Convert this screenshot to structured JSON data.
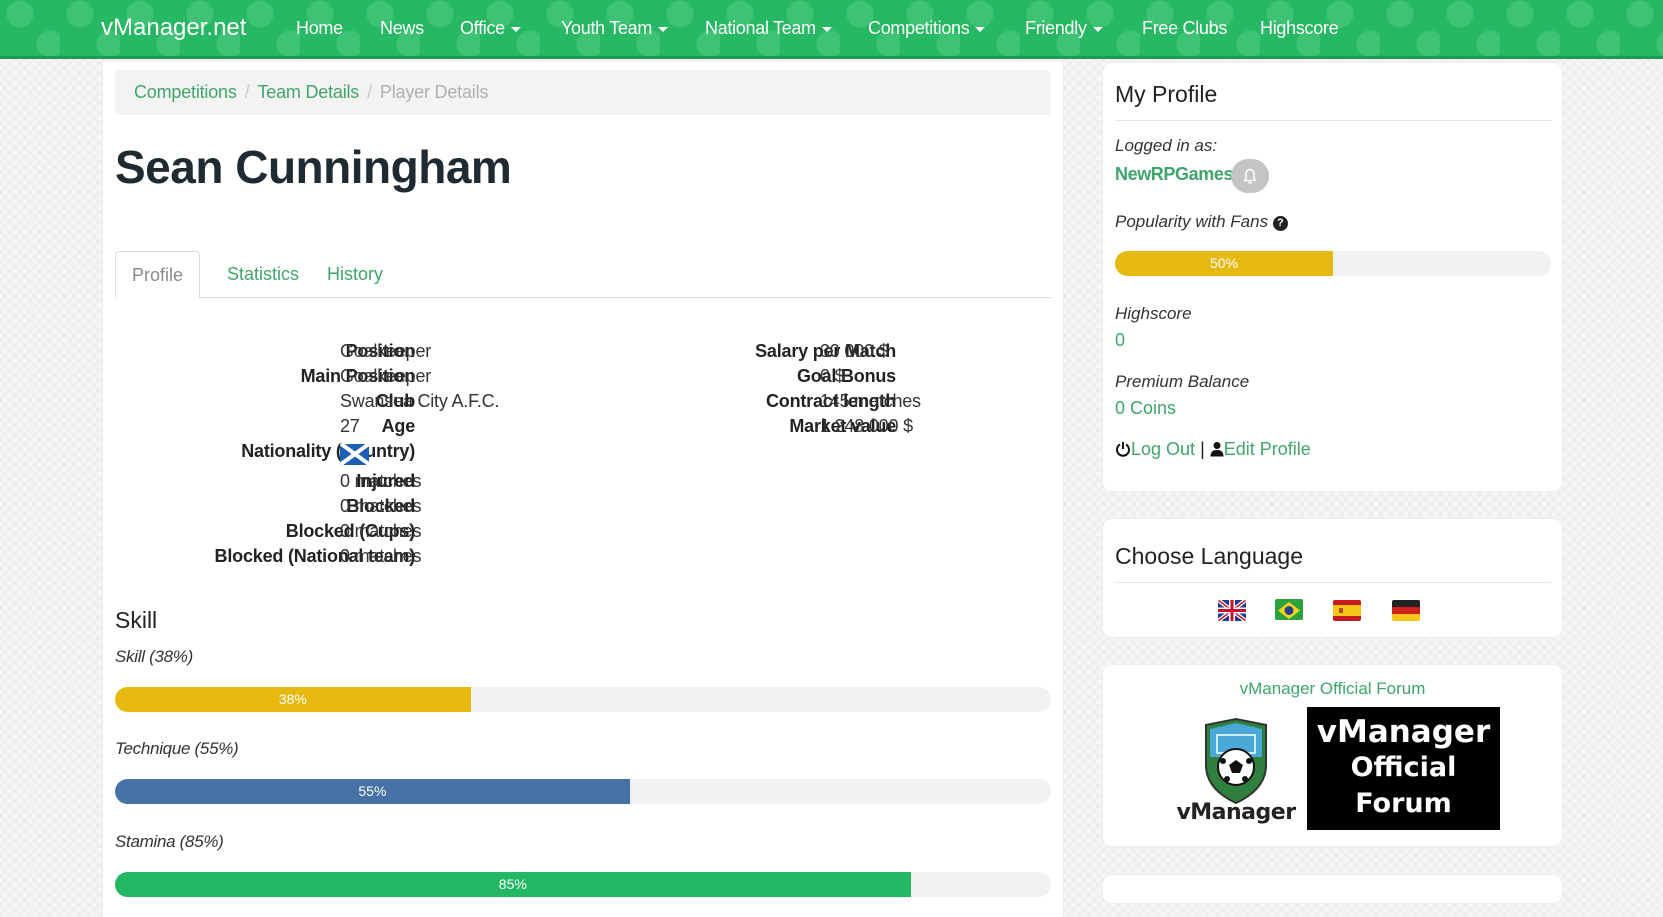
{
  "navbar": {
    "brand": "vManager.net",
    "items": [
      {
        "label": "Home",
        "dropdown": false
      },
      {
        "label": "News",
        "dropdown": false
      },
      {
        "label": "Office",
        "dropdown": true
      },
      {
        "label": "Youth Team",
        "dropdown": true
      },
      {
        "label": "National Team",
        "dropdown": true
      },
      {
        "label": "Competitions",
        "dropdown": true
      },
      {
        "label": "Friendly",
        "dropdown": true
      },
      {
        "label": "Free Clubs",
        "dropdown": false
      },
      {
        "label": "Highscore",
        "dropdown": false
      }
    ],
    "color": "#26b862"
  },
  "breadcrumb": {
    "items": [
      "Competitions",
      "Team Details"
    ],
    "active": "Player Details",
    "separator": "/"
  },
  "player": {
    "name": "Sean Cunningham"
  },
  "tabs": [
    {
      "label": "Profile",
      "active": true
    },
    {
      "label": "Statistics",
      "active": false
    },
    {
      "label": "History",
      "active": false
    }
  ],
  "details_left": [
    {
      "label": "Position",
      "value": "Goalkeeper"
    },
    {
      "label": "Main Position",
      "value": "Goalkeeper"
    },
    {
      "label": "Club",
      "value": "Swansea City A.F.C.",
      "link": true
    },
    {
      "label": "Age",
      "value": "27"
    },
    {
      "label": "Nationality (Country)",
      "value": "",
      "icon": "scotland-flag-icon"
    },
    {
      "label": "Injured",
      "value": "0 matches"
    },
    {
      "label": "Blocked",
      "value": "0 matches"
    },
    {
      "label": "Blocked (Cups)",
      "value": "0 matches"
    },
    {
      "label": "Blocked (National team)",
      "value": "0 matches"
    }
  ],
  "details_right": [
    {
      "label": "Salary per Match",
      "value": "30 000 $"
    },
    {
      "label": "Goal Bonus",
      "value": "0 $"
    },
    {
      "label": "Contract length",
      "value": "145 matches"
    },
    {
      "label": "Market value",
      "value": "1 248 000 $"
    }
  ],
  "skill_section": {
    "title": "Skill",
    "bars": [
      {
        "label": "Skill (38%)",
        "value_percent": 38,
        "text": "38%",
        "color": "#e5b90f"
      },
      {
        "label": "Technique (55%)",
        "value_percent": 55,
        "text": "55%",
        "color": "#4672a5"
      },
      {
        "label": "Stamina (85%)",
        "value_percent": 85,
        "text": "85%",
        "color": "#24b865"
      }
    ]
  },
  "my_profile": {
    "title": "My Profile",
    "logged_in_label": "Logged in as:",
    "username": "NewRPGames",
    "popularity_label": "Popularity with Fans",
    "popularity_percent": 50,
    "popularity_text": "50%",
    "popularity_color": "#e5b90f",
    "highscore_label": "Highscore",
    "highscore_value": "0",
    "premium_label": "Premium Balance",
    "premium_value": "0 Coins",
    "logout_label": "Log Out",
    "separator": "|",
    "edit_profile_label": "Edit Profile"
  },
  "language": {
    "title": "Choose Language",
    "flags": [
      "uk-flag-icon",
      "brazil-flag-icon",
      "spain-flag-icon",
      "germany-flag-icon"
    ]
  },
  "forum": {
    "link_label": "vManager Official Forum",
    "logo_text": "vManager",
    "banner_lines": [
      "vManager",
      "Official",
      "Forum"
    ]
  }
}
